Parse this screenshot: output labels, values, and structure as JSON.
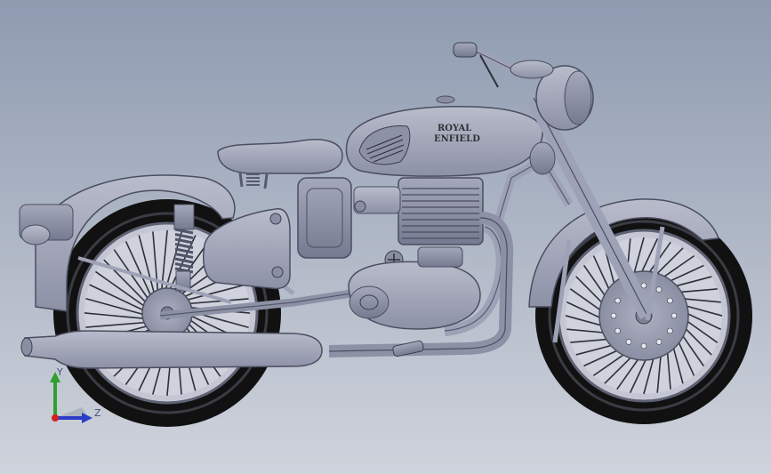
{
  "viewport": {
    "background_top": "#8e9bb0",
    "background_bottom": "#cfd3dc"
  },
  "model": {
    "tank_logo_line1": "ROYAL",
    "tank_logo_line2": "ENFIELD",
    "body_color": "#9ea2b7",
    "tire_color": "#111111"
  },
  "triad": {
    "y_label": "Y",
    "z_label": "Z",
    "y_axis_color": "#2ea02e",
    "z_axis_color": "#2b3cc9",
    "x_axis_color": "#d42020"
  }
}
